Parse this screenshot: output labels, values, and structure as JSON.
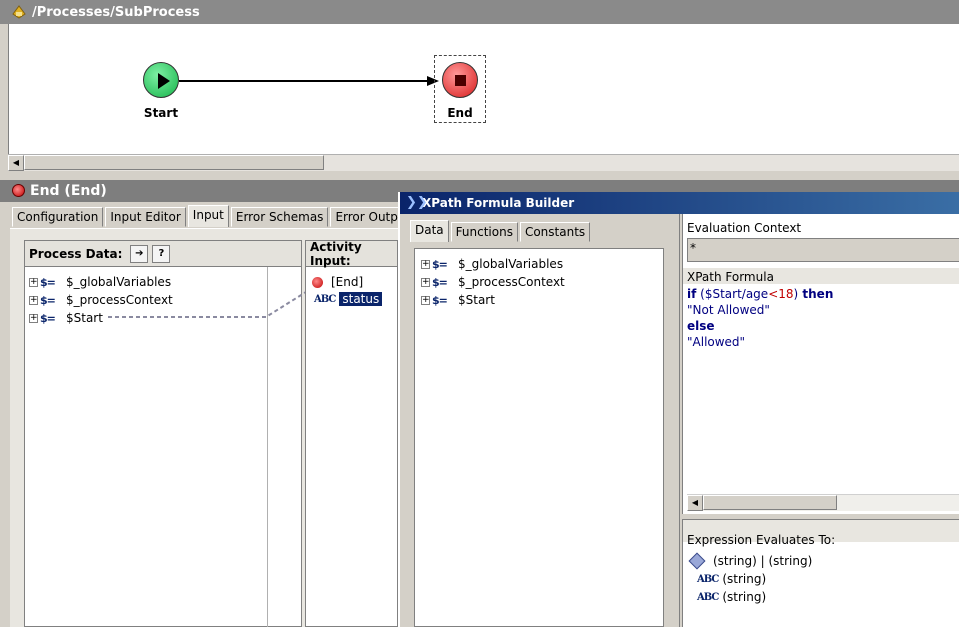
{
  "process": {
    "path": "/Processes/SubProcess",
    "nodes": {
      "start_label": "Start",
      "end_label": "End"
    }
  },
  "end_panel": {
    "title": "End (End)",
    "tabs": [
      "Configuration",
      "Input Editor",
      "Input",
      "Error Schemas",
      "Error Output"
    ],
    "active_tab": "Input",
    "process_data": {
      "header": "Process Data:",
      "items": [
        "$_globalVariables",
        "$_processContext",
        "$Start"
      ]
    },
    "activity_input": {
      "header": "Activity Input:",
      "root": "[End]",
      "field": "status"
    }
  },
  "xpath_builder": {
    "title": "XPath Formula Builder",
    "tabs": [
      "Data",
      "Functions",
      "Constants"
    ],
    "active_tab": "Data",
    "data_items": [
      "$_globalVariables",
      "$_processContext",
      "$Start"
    ],
    "evaluation_context_label": "Evaluation Context",
    "evaluation_context_value": "*",
    "formula_label": "XPath Formula",
    "formula": {
      "if_kw": "if",
      "cond_pre": " ($Start/age",
      "cond_op": "<",
      "cond_num": "18",
      "cond_post": ")",
      "then_kw": " then",
      "then_value": "\"Not Allowed\"",
      "else_kw": "else",
      "else_value": "\"Allowed\""
    },
    "evaluates_label": "Expression Evaluates To:",
    "evaluates_items": [
      "(string) | (string)",
      "(string)",
      "(string)"
    ]
  },
  "colors": {
    "start_green": "#22c55e",
    "end_red": "#e53935",
    "title_blue": "#0a246a"
  }
}
